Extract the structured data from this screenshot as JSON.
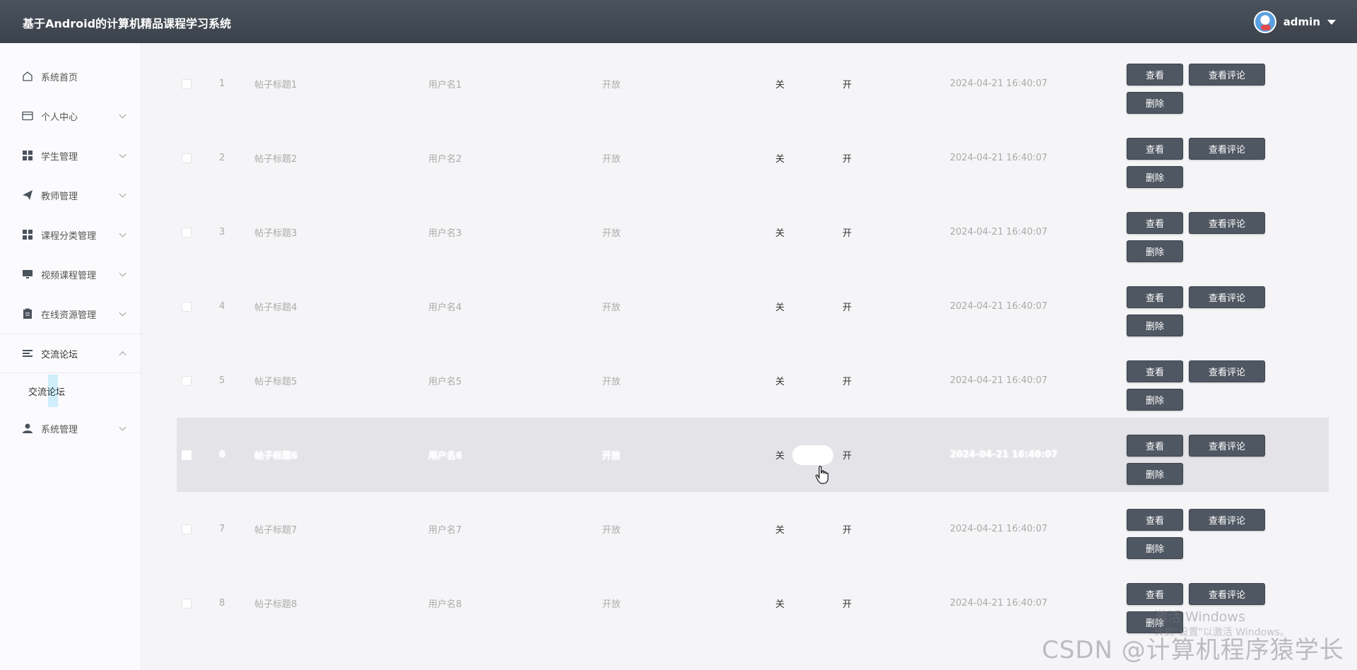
{
  "app": {
    "title": "基于Android的计算机精品课程学习系统",
    "user": "admin"
  },
  "sidebar": {
    "items": [
      {
        "label": "系统首页",
        "icon": "home-icon",
        "expandable": false
      },
      {
        "label": "个人中心",
        "icon": "card-icon",
        "expandable": true
      },
      {
        "label": "学生管理",
        "icon": "grid-icon",
        "expandable": true
      },
      {
        "label": "教师管理",
        "icon": "paper-plane-icon",
        "expandable": true
      },
      {
        "label": "课程分类管理",
        "icon": "grid-icon",
        "expandable": true
      },
      {
        "label": "视频课程管理",
        "icon": "monitor-icon",
        "expandable": true
      },
      {
        "label": "在线资源管理",
        "icon": "clipboard-icon",
        "expandable": true
      },
      {
        "label": "交流论坛",
        "icon": "list-icon",
        "expandable": true,
        "expanded": true
      },
      {
        "label": "系统管理",
        "icon": "user-icon",
        "expandable": true
      }
    ],
    "sub_item": "交流论坛"
  },
  "table": {
    "switch_off_label": "关",
    "switch_on_label": "开",
    "actions": {
      "view": "查看",
      "comments": "查看评论",
      "delete": "删除"
    },
    "rows": [
      {
        "index": "1",
        "title": "帖子标题1",
        "user": "用户名1",
        "status": "开放",
        "time": "2024-04-21 16:40:07"
      },
      {
        "index": "2",
        "title": "帖子标题2",
        "user": "用户名2",
        "status": "开放",
        "time": "2024-04-21 16:40:07"
      },
      {
        "index": "3",
        "title": "帖子标题3",
        "user": "用户名3",
        "status": "开放",
        "time": "2024-04-21 16:40:07"
      },
      {
        "index": "4",
        "title": "帖子标题4",
        "user": "用户名4",
        "status": "开放",
        "time": "2024-04-21 16:40:07"
      },
      {
        "index": "5",
        "title": "帖子标题5",
        "user": "用户名5",
        "status": "开放",
        "time": "2024-04-21 16:40:07"
      },
      {
        "index": "6",
        "title": "帖子标题6",
        "user": "用户名6",
        "status": "开放",
        "time": "2024-04-21 16:40:07",
        "hover": true
      },
      {
        "index": "7",
        "title": "帖子标题7",
        "user": "用户名7",
        "status": "开放",
        "time": "2024-04-21 16:40:07"
      },
      {
        "index": "8",
        "title": "帖子标题8",
        "user": "用户名8",
        "status": "开放",
        "time": "2024-04-21 16:40:07"
      }
    ]
  },
  "watermark": {
    "line1": "激活 Windows",
    "line2": "转到\"设置\"以激活 Windows。",
    "credit": "CSDN @计算机程序猿学长"
  }
}
